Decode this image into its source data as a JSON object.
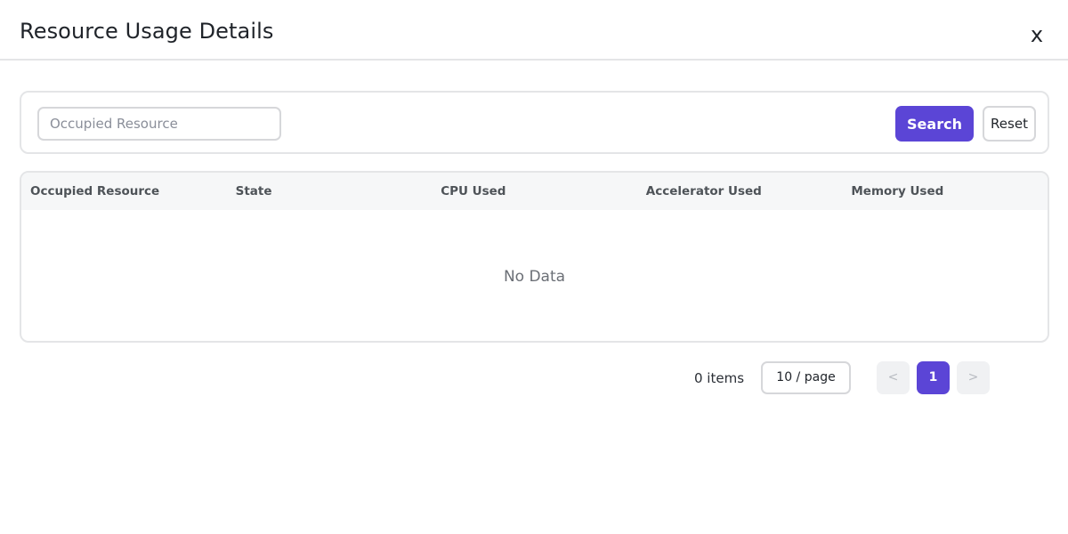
{
  "dialog": {
    "title": "Resource Usage Details",
    "close_label": "x"
  },
  "search": {
    "placeholder": "Occupied Resource",
    "value": "",
    "search_label": "Search",
    "reset_label": "Reset"
  },
  "table": {
    "columns": [
      "Occupied Resource",
      "State",
      "CPU Used",
      "Accelerator Used",
      "Memory Used"
    ],
    "rows": [],
    "empty_text": "No Data"
  },
  "pagination": {
    "total_text": "0 items",
    "page_size": "10 / page",
    "prev_label": "<",
    "current_page": "1",
    "next_label": ">"
  },
  "colors": {
    "accent": "#5b45d6",
    "border": "#e4e5e7",
    "header_bg": "#f6f7f8"
  }
}
